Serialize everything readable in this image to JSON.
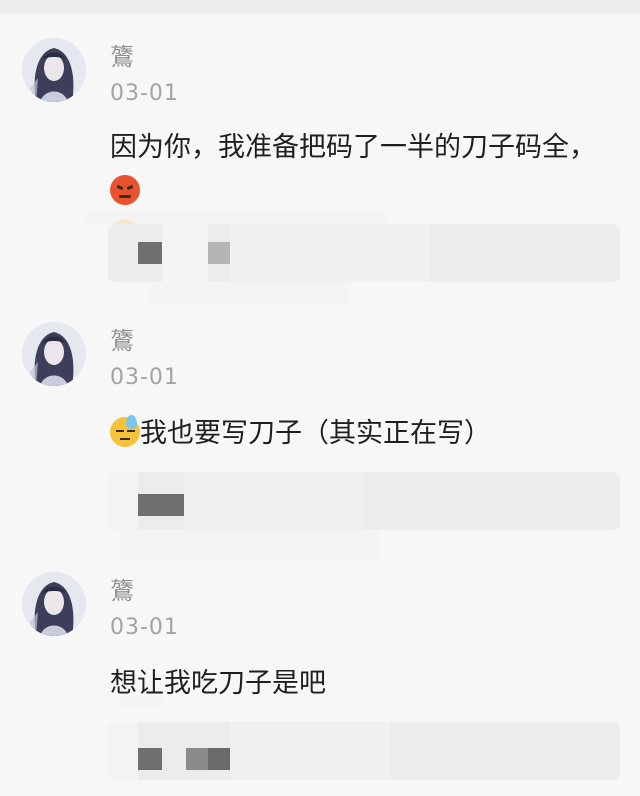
{
  "posts": [
    {
      "author": "鷟",
      "date": "03-01",
      "text": "因为你，我准备把码了一半的刀子码全，",
      "emoji_before": "",
      "emoji_after": [
        "angry-face-icon",
        "confounded-face-icon"
      ]
    },
    {
      "author": "鷟",
      "date": "03-01",
      "text": "我也要写刀子（其实正在写）",
      "emoji_before": "downcast-sweat-face-icon",
      "emoji_after": []
    },
    {
      "author": "鷟",
      "date": "03-01",
      "text": "想让我吃刀子是吧",
      "emoji_before": "",
      "emoji_after": []
    }
  ],
  "colors": {
    "background": "#f7f7f7",
    "name": "#8f8f8f",
    "date": "#a3a3a3",
    "text": "#1f1f1f",
    "quote_box": "#ececec"
  }
}
